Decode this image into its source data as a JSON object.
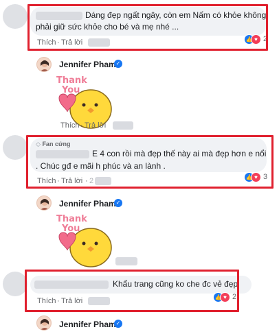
{
  "comments": [
    {
      "text_lines": [
        "Dáng đẹp ngất ngây, còn em Nấm có khỏe không,",
        "phải giữ sức khỏe cho bé và mẹ nhé ..."
      ],
      "actions": {
        "like": "Thích",
        "reply": "Trả lời"
      },
      "reaction_count": "2"
    },
    {
      "badge": "Fan cứng",
      "text_lines": [
        "E 4 con rồi mà đẹp thế này ai mà đẹp hơn e nổi",
        ". Chúc gđ e mãi h phúc và an lành ."
      ],
      "actions": {
        "like": "Thích",
        "reply": "Trả lời",
        "time": "2 giờ"
      },
      "reaction_count": "3"
    },
    {
      "text_lines": [
        "Khẩu trang cũng ko che đc vẻ đẹp"
      ],
      "actions": {
        "like": "Thích",
        "reply": "Trả lời"
      },
      "reaction_count": "2"
    }
  ],
  "replies": [
    {
      "author": "Jennifer Pham",
      "sticker": {
        "line1": "Thank",
        "line2": "You"
      },
      "actions": {
        "like": "Thích",
        "reply": "Trả lời"
      }
    },
    {
      "author": "Jennifer Pham",
      "sticker": {
        "line1": "Thank",
        "line2": "You"
      }
    },
    {
      "author": "Jennifer Pham"
    }
  ],
  "colors": {
    "highlight": "#e0202e",
    "like_blue": "#1877f2",
    "love_red": "#f33e58",
    "sticker_pink": "#ef7d97",
    "sticker_yellow": "#ffd93b"
  },
  "icons": [
    "like-icon",
    "love-icon",
    "verified-icon",
    "diamond-icon",
    "thank-you-sticker"
  ]
}
